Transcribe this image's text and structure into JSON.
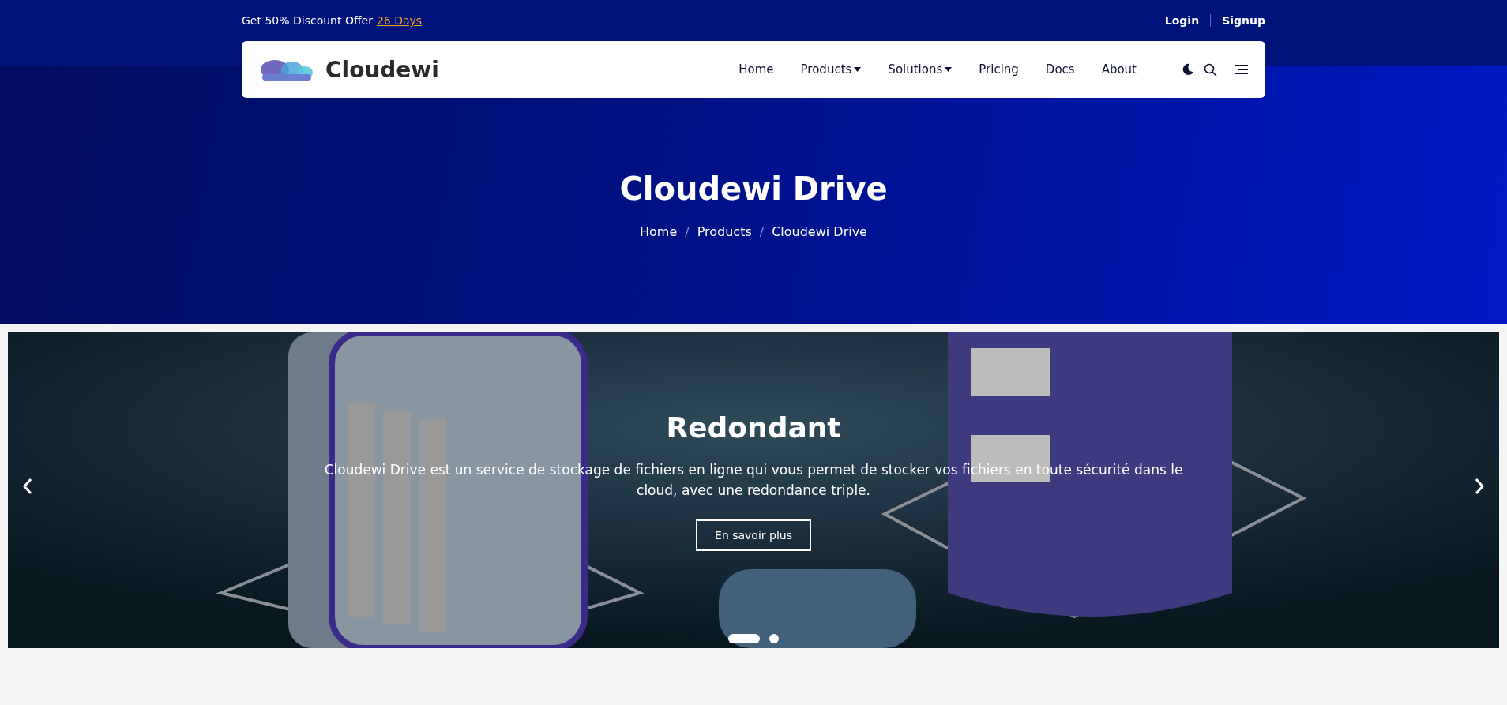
{
  "top_bar": {
    "offer": "Get 50% Discount Offer",
    "offer_link": "26 Days",
    "links": [
      "Login",
      "Signup"
    ]
  },
  "navbar": {
    "brand": "Cloudewi",
    "items": [
      {
        "label": "Home",
        "dropdown": false
      },
      {
        "label": "Products",
        "dropdown": true
      },
      {
        "label": "Solutions",
        "dropdown": true
      },
      {
        "label": "Pricing",
        "dropdown": false
      },
      {
        "label": "Docs",
        "dropdown": false
      },
      {
        "label": "About",
        "dropdown": false
      }
    ]
  },
  "hero": {
    "title": "Cloudewi Drive",
    "breadcrumb": [
      "Home",
      "Products",
      "Cloudewi Drive"
    ],
    "separators": [
      "/",
      "/"
    ]
  },
  "carousel": {
    "title": "Redondant",
    "text": "Cloudewi Drive est un service de stockage de fichiers en ligne qui vous permet de stocker vos fichiers en toute sécurité dans le cloud, avec une redondance triple.",
    "button": "En savoir plus",
    "indicators": [
      {
        "selected": true
      },
      {
        "selected": false
      }
    ]
  }
}
